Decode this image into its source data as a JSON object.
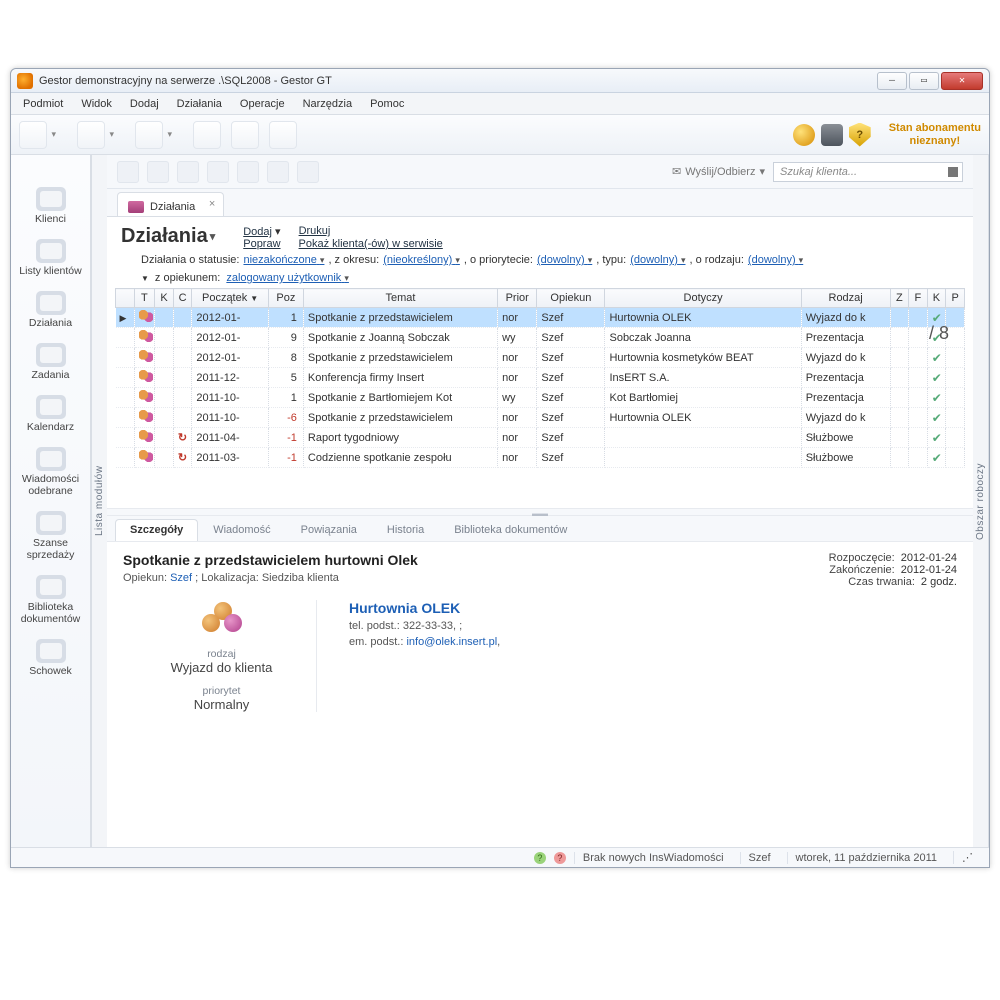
{
  "titlebar": {
    "title": "Gestor demonstracyjny na serwerze .\\SQL2008 - Gestor GT"
  },
  "menu": [
    "Podmiot",
    "Widok",
    "Dodaj",
    "Działania",
    "Operacje",
    "Narzędzia",
    "Pomoc"
  ],
  "abonament": {
    "line1": "Stan abonamentu",
    "line2": "nieznany!"
  },
  "modules": [
    "Klienci",
    "Listy klientów",
    "Działania",
    "Zadania",
    "Kalendarz",
    "Wiadomości odebrane",
    "Szanse sprzedaży",
    "Biblioteka dokumentów",
    "Schowek"
  ],
  "listbar_label": "Lista modułów",
  "rightbar_label": "Obszar roboczy",
  "subtoolbar": {
    "send": "Wyślij/Odbierz",
    "search_placeholder": "Szukaj klienta..."
  },
  "tab": {
    "label": "Działania"
  },
  "header": {
    "title": "Działania",
    "actions": {
      "add": "Dodaj",
      "fix": "Popraw",
      "print": "Drukuj",
      "show": "Pokaż klienta(-ów) w serwisie"
    }
  },
  "filters": {
    "pre": "Działania o statusie:",
    "status": "niezakończone",
    "seg_period_pre": ", z okresu:",
    "period": "(nieokreślony)",
    "seg_prio_pre": ", o priorytecie:",
    "prio": "(dowolny)",
    "seg_type_pre": ", typu:",
    "type": "(dowolny)",
    "seg_kind_pre": ", o rodzaju:",
    "kind": "(dowolny)",
    "row2_pre": "z opiekunem:",
    "owner": "zalogowany użytkownik"
  },
  "count_suffix": "/ 8",
  "grid": {
    "cols": [
      "",
      "T",
      "K",
      "C",
      "Początek",
      "Poz",
      "Temat",
      "Prior",
      "Opiekun",
      "Dotyczy",
      "Rodzaj",
      "Z",
      "F",
      "K",
      "P"
    ],
    "rows": [
      {
        "sel": true,
        "rec": false,
        "start": "2012-01-",
        "poz": "1",
        "temat": "Spotkanie z przedstawicielem",
        "prior": "nor",
        "op": "Szef",
        "dot": "Hurtownia OLEK",
        "rodz": "Wyjazd do k",
        "k": true
      },
      {
        "sel": false,
        "rec": false,
        "start": "2012-01-",
        "poz": "9",
        "temat": "Spotkanie z Joanną Sobczak",
        "prior": "wy",
        "op": "Szef",
        "dot": "Sobczak Joanna",
        "rodz": "Prezentacja",
        "k": true
      },
      {
        "sel": false,
        "rec": false,
        "start": "2012-01-",
        "poz": "8",
        "temat": "Spotkanie z przedstawicielem",
        "prior": "nor",
        "op": "Szef",
        "dot": "Hurtownia kosmetyków BEAT",
        "rodz": "Wyjazd do k",
        "k": true
      },
      {
        "sel": false,
        "rec": false,
        "start": "2011-12-",
        "poz": "5",
        "temat": "Konferencja firmy Insert",
        "prior": "nor",
        "op": "Szef",
        "dot": "InsERT S.A.",
        "rodz": "Prezentacja",
        "k": true
      },
      {
        "sel": false,
        "rec": false,
        "start": "2011-10-",
        "poz": "1",
        "temat": "Spotkanie z Bartłomiejem Kot",
        "prior": "wy",
        "op": "Szef",
        "dot": "Kot Bartłomiej",
        "rodz": "Prezentacja",
        "k": true
      },
      {
        "sel": false,
        "rec": false,
        "start": "2011-10-",
        "poz": "-6",
        "temat": "Spotkanie z przedstawicielem",
        "prior": "nor",
        "op": "Szef",
        "dot": "Hurtownia OLEK",
        "rodz": "Wyjazd do k",
        "k": true
      },
      {
        "sel": false,
        "rec": true,
        "start": "2011-04-",
        "poz": "-1",
        "temat": "Raport tygodniowy",
        "prior": "nor",
        "op": "Szef",
        "dot": "",
        "rodz": "Służbowe",
        "k": true
      },
      {
        "sel": false,
        "rec": true,
        "start": "2011-03-",
        "poz": "-1",
        "temat": "Codzienne spotkanie zespołu",
        "prior": "nor",
        "op": "Szef",
        "dot": "",
        "rodz": "Służbowe",
        "k": true
      }
    ]
  },
  "detail_tabs": [
    "Szczegóły",
    "Wiadomość",
    "Powiązania",
    "Historia",
    "Biblioteka dokumentów"
  ],
  "detail": {
    "title": "Spotkanie z przedstawicielem hurtowni Olek",
    "owner_label": "Opiekun:",
    "owner": "Szef",
    "loc_label": "; Lokalizacja:",
    "loc": "Siedziba klienta",
    "start_label": "Rozpoczęcie:",
    "start": "2012-01-24",
    "end_label": "Zakończenie:",
    "end": "2012-01-24",
    "dur_label": "Czas trwania:",
    "dur": "2 godz.",
    "kind_label": "rodzaj",
    "kind": "Wyjazd do klienta",
    "prio_label": "priorytet",
    "prio": "Normalny",
    "client_name": "Hurtownia OLEK",
    "tel_label": "tel. podst.:",
    "tel": "322-33-33, ;",
    "em_label": "em. podst.:",
    "email": "info@olek.insert.pl",
    "email_tail": ","
  },
  "status": {
    "msg": "Brak nowych InsWiadomości",
    "user": "Szef",
    "date": "wtorek, 11 października 2011"
  }
}
